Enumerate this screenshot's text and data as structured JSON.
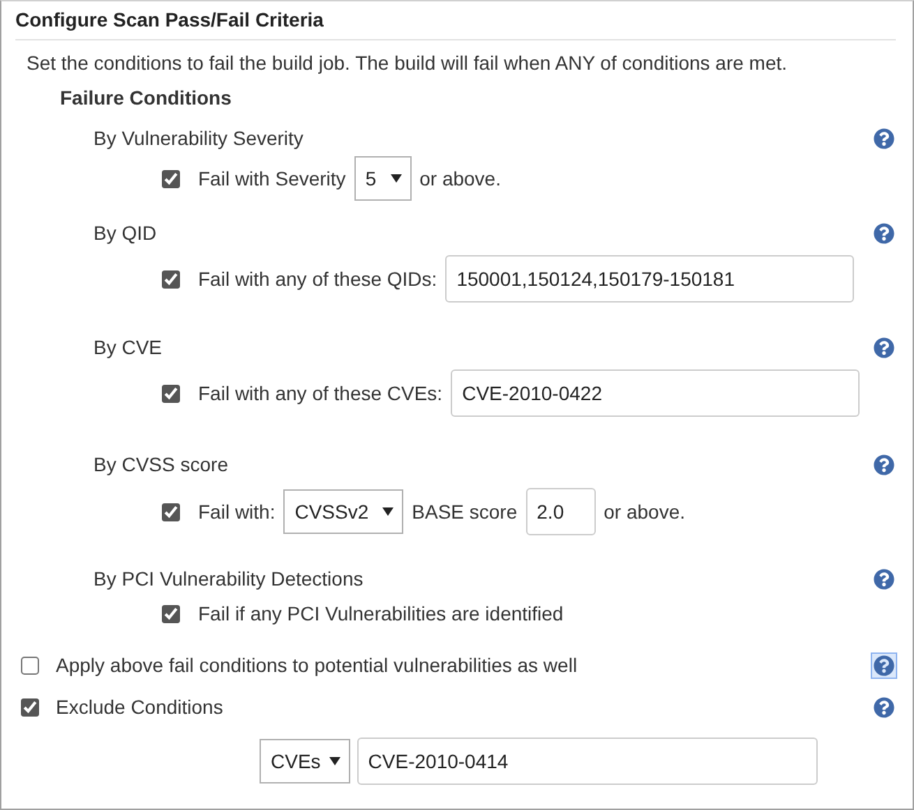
{
  "title": "Configure Scan Pass/Fail Criteria",
  "description": "Set the conditions to fail the build job. The build will fail when ANY of conditions are met.",
  "heading": "Failure Conditions",
  "conditions": [
    {
      "kind": "select",
      "label": "By Vulnerability Severity",
      "checked": true,
      "text": "Fail with Severity",
      "select": "5",
      "suffix": "or above."
    },
    {
      "kind": "input",
      "label": "By QID",
      "checked": true,
      "text": "Fail with any of these QIDs:",
      "value": "150001,150124,150179-150181"
    },
    {
      "kind": "input",
      "label": "By CVE",
      "checked": true,
      "text": "Fail with any of these CVEs:",
      "value": "CVE-2010-0422"
    },
    {
      "kind": "cvss",
      "label": "By CVSS score",
      "checked": true,
      "text": "Fail with:",
      "select": "CVSSv2",
      "middle": "BASE score",
      "value": "2.0",
      "suffix": "or above."
    },
    {
      "kind": "plain",
      "label": "By PCI Vulnerability Detections",
      "checked": true,
      "text": "Fail if any PCI Vulnerabilities are identified"
    }
  ],
  "options": [
    {
      "label": "Apply above fail conditions to potential vulnerabilities as well",
      "checked": false,
      "help_focused": true
    },
    {
      "label": "Exclude Conditions",
      "checked": true,
      "help_focused": false
    }
  ],
  "exclude": {
    "select": "CVEs",
    "value": "CVE-2010-0414"
  }
}
